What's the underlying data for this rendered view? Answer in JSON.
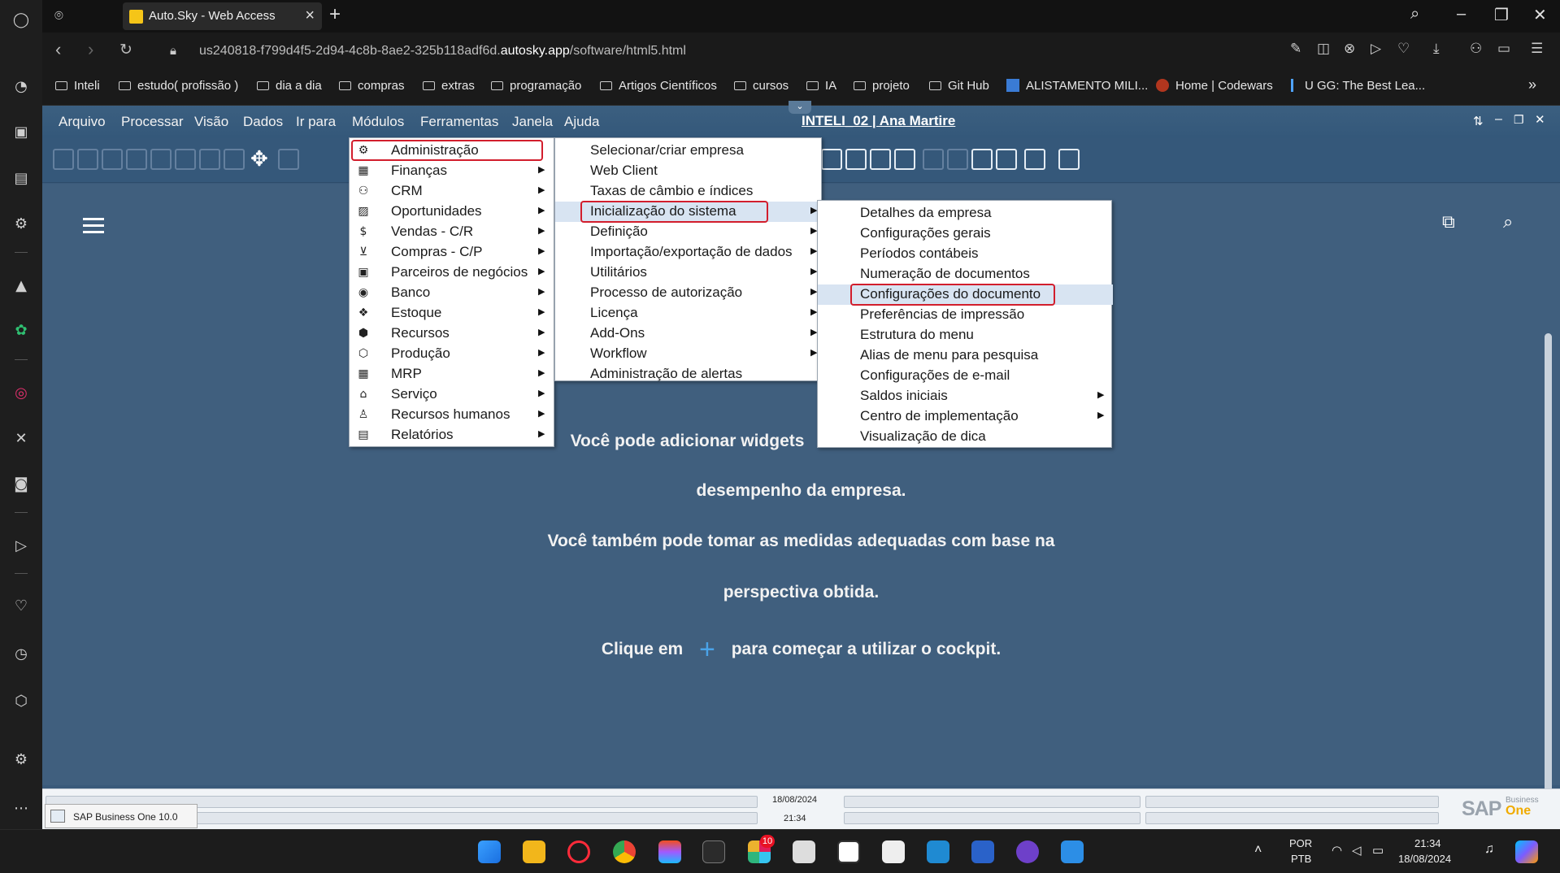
{
  "browser": {
    "tab_title": "Auto.Sky - Web Access",
    "url_prefix": "us240818-f799d4f5-2d94-4c8b-8ae2-325b118adf6d.",
    "url_domain": "autosky.app",
    "url_path": "/software/html5.html",
    "bookmarks": [
      "Inteli",
      "estudo( profissão )",
      "dia a dia",
      "compras",
      "extras",
      "programação",
      "Artigos Científicos",
      "cursos",
      "IA",
      "projeto",
      "Git Hub",
      "ALISTAMENTO MILI...",
      "Home | Codewars",
      "U GG: The Best Lea..."
    ]
  },
  "menubar": {
    "items": [
      "Arquivo",
      "Processar",
      "Visão",
      "Dados",
      "Ir para",
      "Módulos",
      "Ferramentas",
      "Janela",
      "Ajuda"
    ],
    "context_title": "INTELI_02 | Ana Martire"
  },
  "modules_menu": {
    "items": [
      {
        "label": "Administração",
        "icon": "gear-icon"
      },
      {
        "label": "Finanças",
        "icon": "finance-icon"
      },
      {
        "label": "CRM",
        "icon": "people-icon"
      },
      {
        "label": "Oportunidades",
        "icon": "chart-icon"
      },
      {
        "label": "Vendas - C/R",
        "icon": "dollar-icon"
      },
      {
        "label": "Compras - C/P",
        "icon": "cart-icon"
      },
      {
        "label": "Parceiros de negócios",
        "icon": "contacts-icon"
      },
      {
        "label": "Banco",
        "icon": "bank-icon"
      },
      {
        "label": "Estoque",
        "icon": "inventory-icon"
      },
      {
        "label": "Recursos",
        "icon": "cube-icon"
      },
      {
        "label": "Produção",
        "icon": "production-icon"
      },
      {
        "label": "MRP",
        "icon": "calendar-icon"
      },
      {
        "label": "Serviço",
        "icon": "service-icon"
      },
      {
        "label": "Recursos humanos",
        "icon": "person-icon"
      },
      {
        "label": "Relatórios",
        "icon": "report-icon"
      }
    ]
  },
  "admin_menu": {
    "items": [
      "Selecionar/criar empresa",
      "Web Client",
      "Taxas de câmbio e índices",
      "Inicialização do sistema",
      "Definição",
      "Importação/exportação de dados",
      "Utilitários",
      "Processo de autorização",
      "Licença",
      "Add-Ons",
      "Workflow",
      "Administração de alertas"
    ]
  },
  "init_menu": {
    "items": [
      "Detalhes da empresa",
      "Configurações gerais",
      "Períodos contábeis",
      "Numeração de documentos",
      "Configurações do documento",
      "Preferências de impressão",
      "Estrutura do menu",
      "Alias de menu para pesquisa",
      "Configurações de e-mail",
      "Saldos iniciais",
      "Centro de implementação",
      "Visualização de dica"
    ]
  },
  "cockpit": {
    "line1": "Você pode adicionar widgets",
    "line2": "desempenho da empresa.",
    "line3": "Você também pode tomar as medidas adequadas com base na",
    "line4": "perspectiva obtida.",
    "line5_a": "Clique em",
    "line5_b": "para começar a utilizar o cockpit."
  },
  "statusbar": {
    "date": "18/08/2024",
    "time": "21:34",
    "taskbar_item": "SAP Business One 10.0",
    "brand": "SAP",
    "brand_sub1": "Business",
    "brand_sub2": "One"
  },
  "taskbar": {
    "lang1": "POR",
    "lang2": "PTB",
    "time": "21:34",
    "date": "18/08/2024",
    "badge": "10"
  }
}
